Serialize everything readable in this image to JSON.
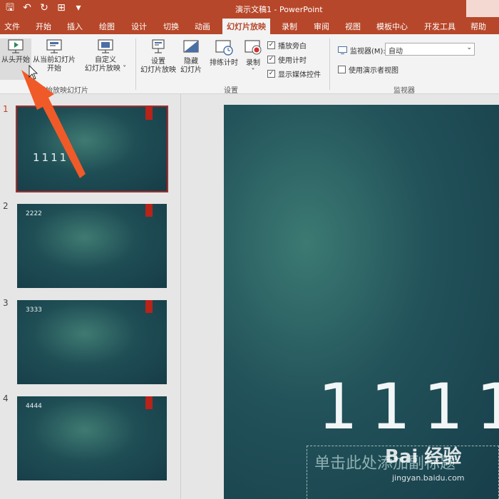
{
  "titlebar": {
    "doc_title": "演示文稿1  -  PowerPoint"
  },
  "menu": {
    "tabs": [
      "文件",
      "开始",
      "插入",
      "绘图",
      "设计",
      "切换",
      "动画",
      "幻灯片放映",
      "录制",
      "审阅",
      "视图",
      "模板中心",
      "开发工具",
      "帮助"
    ],
    "active": "幻灯片放映"
  },
  "ribbon": {
    "from_start": "从头开始",
    "from_current_1": "从当前幻灯片",
    "from_current_2": "开始",
    "custom_1": "自定义",
    "custom_2": "幻灯片放映 ˅",
    "group_start_label": "开始放映幻灯片",
    "setup_1": "设置",
    "setup_2": "幻灯片放映",
    "hide_1": "隐藏",
    "hide_2": "幻灯片",
    "rehearse": "排练计时",
    "record": "录制",
    "record_arrow": "˅",
    "chk_narration": "播放旁白",
    "chk_timing": "使用计时",
    "chk_media": "显示媒体控件",
    "group_setup_label": "设置",
    "monitor_label": "监视器(M):",
    "monitor_value": "自动",
    "presenter_view": "使用演示者视图",
    "group_monitor_label": "监视器"
  },
  "slides": [
    {
      "num": "1",
      "text": "1111"
    },
    {
      "num": "2",
      "text": "2222"
    },
    {
      "num": "3",
      "text": "3333"
    },
    {
      "num": "4",
      "text": "4444"
    }
  ],
  "main_slide": {
    "title": "1111",
    "subtitle": "单击此处添加副标题"
  },
  "watermark": {
    "brand": "Bai 经验",
    "url": "jingyan.baidu.com"
  },
  "colors": {
    "accent": "#b7472a",
    "slide_dark": "#173e4a",
    "slide_light": "#3c7a73",
    "arrow": "#f05a28"
  }
}
